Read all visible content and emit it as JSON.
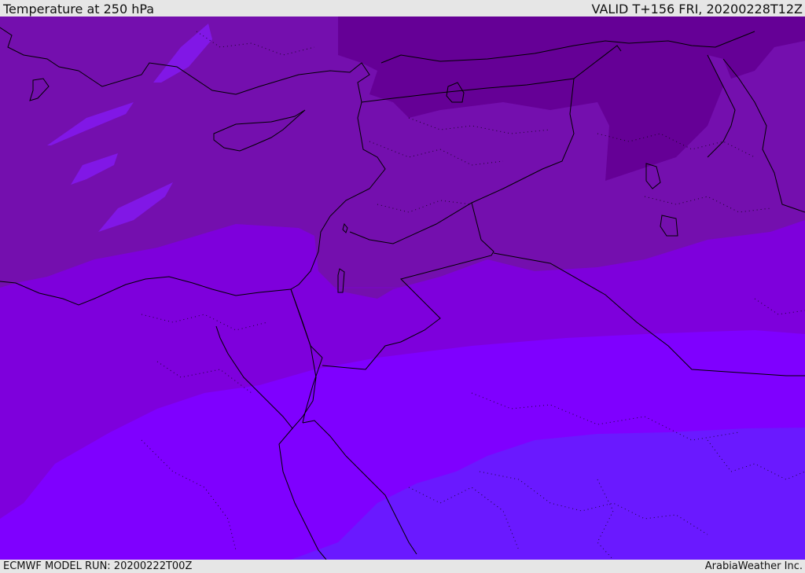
{
  "header": {
    "title": "Temperature at 250 hPa",
    "valid": "VALID T+156 FRI, 20200228T12Z"
  },
  "footer": {
    "model_run": "ECMWF MODEL RUN: 20200222T00Z",
    "credit": "ArabiaWeather Inc."
  },
  "colors": {
    "band_coldest": "#650096",
    "band_cold": "#740fae",
    "band_mid": "#7e00dc",
    "band_warm": "#7f00ff",
    "band_warmest": "#6a19ff",
    "band_light_streak": "#8117e6",
    "coastline": "#000000",
    "border": "#000000"
  }
}
